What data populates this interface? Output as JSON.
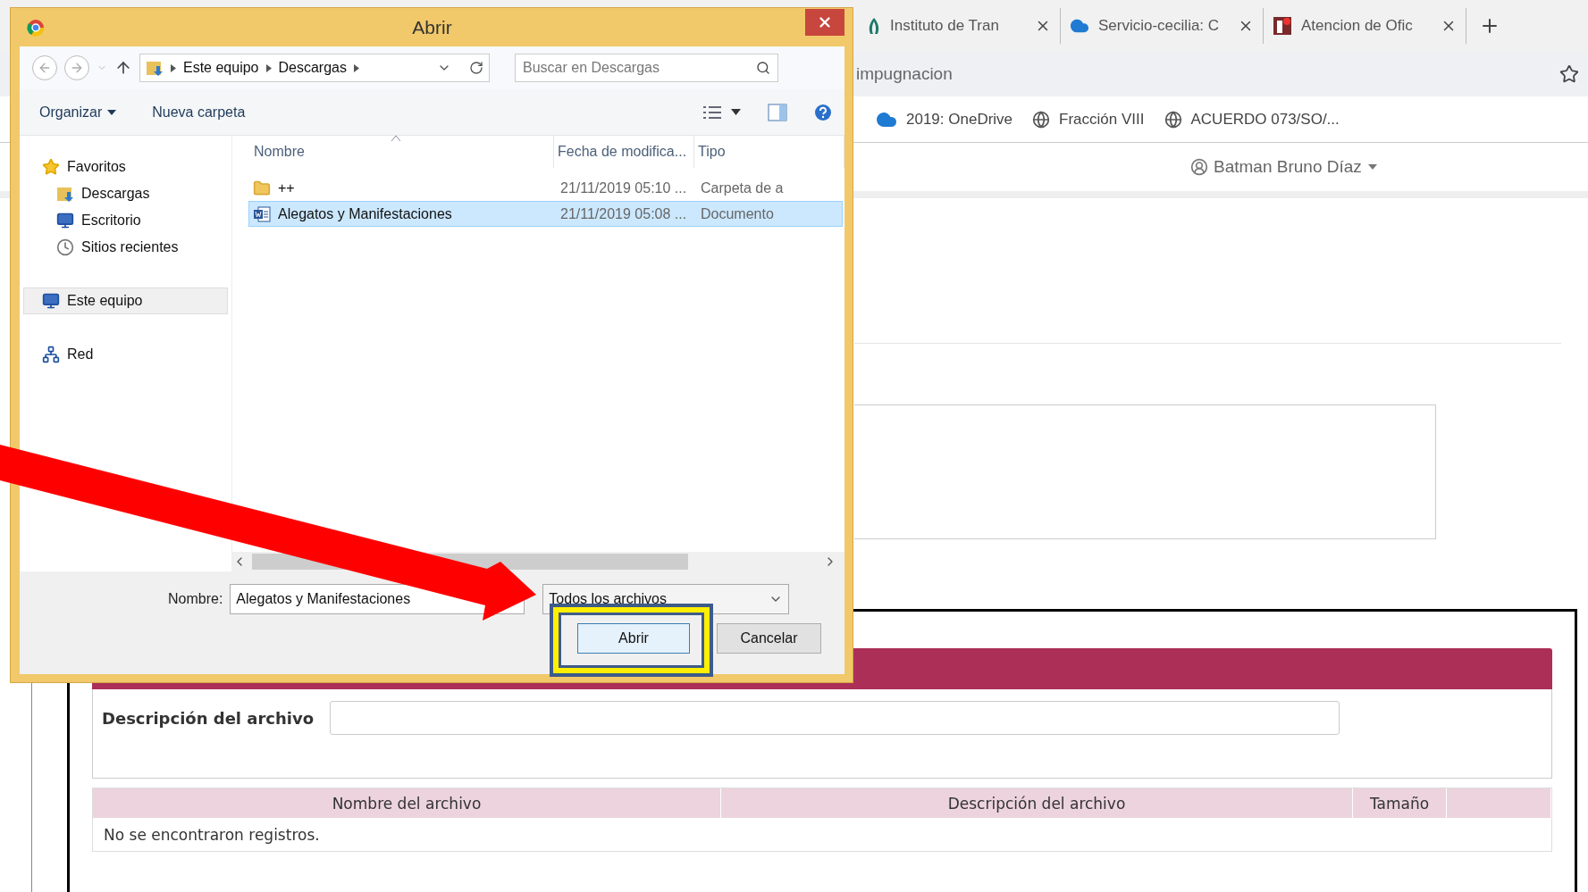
{
  "browser": {
    "tabs": [
      {
        "title": "Instituto de Tran",
        "kind": "leaf",
        "selected": false
      },
      {
        "title": "Servicio-cecilia: C",
        "kind": "cloud",
        "selected": false
      },
      {
        "title": "Atencion de Ofic",
        "kind": "office",
        "selected": false
      }
    ],
    "address": "impugnacion",
    "bookmarks": [
      {
        "label": "2019: OneDrive",
        "kind": "cloud"
      },
      {
        "label": "Fracción VIII",
        "kind": "globe"
      },
      {
        "label": "ACUERDO 073/SO/...",
        "kind": "globe"
      }
    ],
    "user": "Batman Bruno Díaz"
  },
  "page": {
    "description_label": "Descripción del archivo",
    "columns": [
      "Nombre del archivo",
      "Descripción del archivo",
      "Tamaño"
    ],
    "empty_message": "No se encontraron registros."
  },
  "dialog": {
    "title": "Abrir",
    "breadcrumb": [
      "Este equipo",
      "Descargas"
    ],
    "search_placeholder": "Buscar en Descargas",
    "toolbar": [
      "Organizar",
      "Nueva carpeta"
    ],
    "nav": [
      {
        "label": "Favoritos",
        "kind": "star",
        "selected": false,
        "children": [
          {
            "label": "Descargas",
            "kind": "downloads",
            "selected": false
          },
          {
            "label": "Escritorio",
            "kind": "desktop",
            "selected": false
          },
          {
            "label": "Sitios recientes",
            "kind": "recent",
            "selected": false
          }
        ]
      },
      {
        "label": "Este equipo",
        "kind": "computer",
        "selected": true
      },
      {
        "label": "Red",
        "kind": "network",
        "selected": false
      }
    ],
    "columns": [
      "Nombre",
      "Fecha de modifica...",
      "Tipo"
    ],
    "files": [
      {
        "name": "++",
        "date": "21/11/2019 05:10 ...",
        "type": "Carpeta de a",
        "kind": "folder",
        "selected": false
      },
      {
        "name": "Alegatos y Manifestaciones",
        "date": "21/11/2019 05:08 ...",
        "type": "Documento",
        "kind": "word",
        "selected": true
      }
    ],
    "filename_label": "Nombre:",
    "filename": "Alegatos y Manifestaciones",
    "filter": "Todos los archivos",
    "buttons": [
      "Abrir",
      "Cancelar"
    ]
  }
}
